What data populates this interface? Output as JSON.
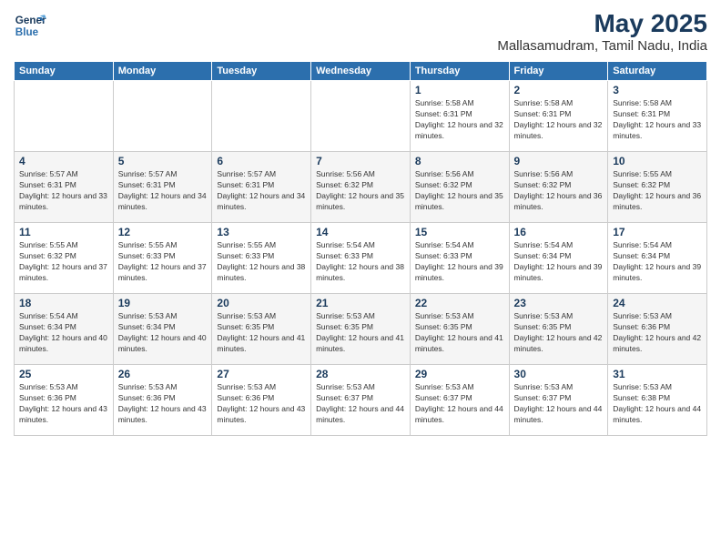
{
  "logo": {
    "line1": "General",
    "line2": "Blue"
  },
  "title": "May 2025",
  "subtitle": "Mallasamudram, Tamil Nadu, India",
  "headers": [
    "Sunday",
    "Monday",
    "Tuesday",
    "Wednesday",
    "Thursday",
    "Friday",
    "Saturday"
  ],
  "weeks": [
    [
      {
        "day": "",
        "sunrise": "",
        "sunset": "",
        "daylight": ""
      },
      {
        "day": "",
        "sunrise": "",
        "sunset": "",
        "daylight": ""
      },
      {
        "day": "",
        "sunrise": "",
        "sunset": "",
        "daylight": ""
      },
      {
        "day": "",
        "sunrise": "",
        "sunset": "",
        "daylight": ""
      },
      {
        "day": "1",
        "sunrise": "5:58 AM",
        "sunset": "6:31 PM",
        "daylight": "12 hours and 32 minutes."
      },
      {
        "day": "2",
        "sunrise": "5:58 AM",
        "sunset": "6:31 PM",
        "daylight": "12 hours and 32 minutes."
      },
      {
        "day": "3",
        "sunrise": "5:58 AM",
        "sunset": "6:31 PM",
        "daylight": "12 hours and 33 minutes."
      }
    ],
    [
      {
        "day": "4",
        "sunrise": "5:57 AM",
        "sunset": "6:31 PM",
        "daylight": "12 hours and 33 minutes."
      },
      {
        "day": "5",
        "sunrise": "5:57 AM",
        "sunset": "6:31 PM",
        "daylight": "12 hours and 34 minutes."
      },
      {
        "day": "6",
        "sunrise": "5:57 AM",
        "sunset": "6:31 PM",
        "daylight": "12 hours and 34 minutes."
      },
      {
        "day": "7",
        "sunrise": "5:56 AM",
        "sunset": "6:32 PM",
        "daylight": "12 hours and 35 minutes."
      },
      {
        "day": "8",
        "sunrise": "5:56 AM",
        "sunset": "6:32 PM",
        "daylight": "12 hours and 35 minutes."
      },
      {
        "day": "9",
        "sunrise": "5:56 AM",
        "sunset": "6:32 PM",
        "daylight": "12 hours and 36 minutes."
      },
      {
        "day": "10",
        "sunrise": "5:55 AM",
        "sunset": "6:32 PM",
        "daylight": "12 hours and 36 minutes."
      }
    ],
    [
      {
        "day": "11",
        "sunrise": "5:55 AM",
        "sunset": "6:32 PM",
        "daylight": "12 hours and 37 minutes."
      },
      {
        "day": "12",
        "sunrise": "5:55 AM",
        "sunset": "6:33 PM",
        "daylight": "12 hours and 37 minutes."
      },
      {
        "day": "13",
        "sunrise": "5:55 AM",
        "sunset": "6:33 PM",
        "daylight": "12 hours and 38 minutes."
      },
      {
        "day": "14",
        "sunrise": "5:54 AM",
        "sunset": "6:33 PM",
        "daylight": "12 hours and 38 minutes."
      },
      {
        "day": "15",
        "sunrise": "5:54 AM",
        "sunset": "6:33 PM",
        "daylight": "12 hours and 39 minutes."
      },
      {
        "day": "16",
        "sunrise": "5:54 AM",
        "sunset": "6:34 PM",
        "daylight": "12 hours and 39 minutes."
      },
      {
        "day": "17",
        "sunrise": "5:54 AM",
        "sunset": "6:34 PM",
        "daylight": "12 hours and 39 minutes."
      }
    ],
    [
      {
        "day": "18",
        "sunrise": "5:54 AM",
        "sunset": "6:34 PM",
        "daylight": "12 hours and 40 minutes."
      },
      {
        "day": "19",
        "sunrise": "5:53 AM",
        "sunset": "6:34 PM",
        "daylight": "12 hours and 40 minutes."
      },
      {
        "day": "20",
        "sunrise": "5:53 AM",
        "sunset": "6:35 PM",
        "daylight": "12 hours and 41 minutes."
      },
      {
        "day": "21",
        "sunrise": "5:53 AM",
        "sunset": "6:35 PM",
        "daylight": "12 hours and 41 minutes."
      },
      {
        "day": "22",
        "sunrise": "5:53 AM",
        "sunset": "6:35 PM",
        "daylight": "12 hours and 41 minutes."
      },
      {
        "day": "23",
        "sunrise": "5:53 AM",
        "sunset": "6:35 PM",
        "daylight": "12 hours and 42 minutes."
      },
      {
        "day": "24",
        "sunrise": "5:53 AM",
        "sunset": "6:36 PM",
        "daylight": "12 hours and 42 minutes."
      }
    ],
    [
      {
        "day": "25",
        "sunrise": "5:53 AM",
        "sunset": "6:36 PM",
        "daylight": "12 hours and 43 minutes."
      },
      {
        "day": "26",
        "sunrise": "5:53 AM",
        "sunset": "6:36 PM",
        "daylight": "12 hours and 43 minutes."
      },
      {
        "day": "27",
        "sunrise": "5:53 AM",
        "sunset": "6:36 PM",
        "daylight": "12 hours and 43 minutes."
      },
      {
        "day": "28",
        "sunrise": "5:53 AM",
        "sunset": "6:37 PM",
        "daylight": "12 hours and 44 minutes."
      },
      {
        "day": "29",
        "sunrise": "5:53 AM",
        "sunset": "6:37 PM",
        "daylight": "12 hours and 44 minutes."
      },
      {
        "day": "30",
        "sunrise": "5:53 AM",
        "sunset": "6:37 PM",
        "daylight": "12 hours and 44 minutes."
      },
      {
        "day": "31",
        "sunrise": "5:53 AM",
        "sunset": "6:38 PM",
        "daylight": "12 hours and 44 minutes."
      }
    ]
  ]
}
